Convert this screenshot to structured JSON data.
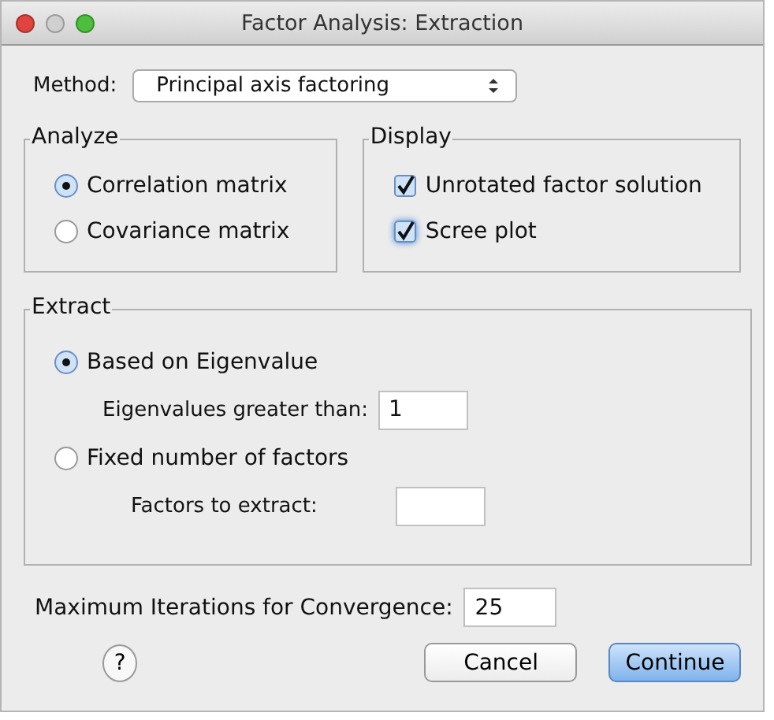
{
  "window": {
    "title": "Factor Analysis: Extraction"
  },
  "method": {
    "label": "Method:",
    "value": "Principal axis factoring"
  },
  "analyze": {
    "title": "Analyze",
    "options": [
      {
        "label": "Correlation matrix",
        "selected": true
      },
      {
        "label": "Covariance matrix",
        "selected": false
      }
    ]
  },
  "display": {
    "title": "Display",
    "options": [
      {
        "label": "Unrotated factor solution",
        "checked": true,
        "focused": false
      },
      {
        "label": "Scree plot",
        "checked": true,
        "focused": true
      }
    ]
  },
  "extract": {
    "title": "Extract",
    "options": [
      {
        "label": "Based on Eigenvalue",
        "selected": true,
        "field": {
          "label": "Eigenvalues greater than:",
          "value": "1"
        }
      },
      {
        "label": "Fixed number of factors",
        "selected": false,
        "field": {
          "label": "Factors to extract:"
        }
      }
    ]
  },
  "max_iterations": {
    "label": "Maximum Iterations for Convergence:",
    "value": "25"
  },
  "buttons": [
    {
      "kind": "help",
      "label": "?"
    },
    {
      "kind": "cancel",
      "label": "Cancel"
    },
    {
      "kind": "default",
      "label": "Continue"
    }
  ]
}
